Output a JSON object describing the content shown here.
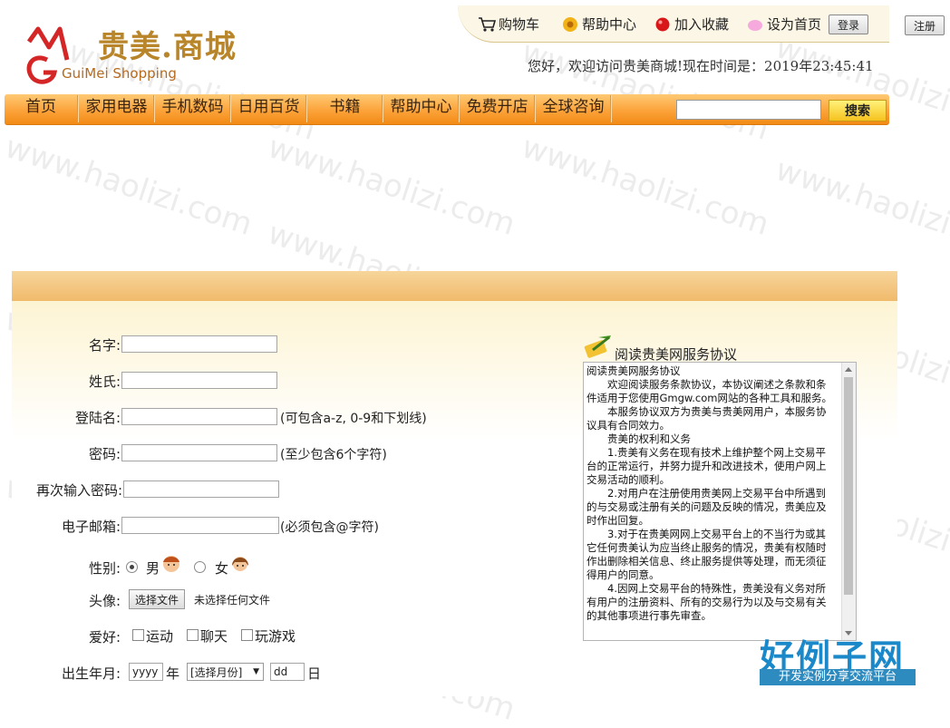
{
  "brand": {
    "name_cn": "贵美.商城",
    "name_en": "GuiMei Shopping",
    "color": "#b8852a"
  },
  "topnav": {
    "cart": "购物车",
    "help": "帮助中心",
    "favorite": "加入收藏",
    "homepage": "设为首页",
    "login": "登录",
    "register": "注册"
  },
  "welcome": "您好，欢迎访问贵美商城!现在时间是：2019年23:45:41",
  "nav": {
    "items": [
      "首页",
      "家用电器",
      "手机数码",
      "日用百货",
      "书籍",
      "帮助中心",
      "免费开店",
      "全球咨询"
    ],
    "search_button": "搜索",
    "accent": "#f6a23a"
  },
  "form": {
    "first_name_label": "名字:",
    "last_name_label": "姓氏:",
    "username_label": "登陆名:",
    "username_hint": "(可包含a-z, 0-9和下划线)",
    "password_label": "密码:",
    "password_hint": "(至少包含6个字符)",
    "password2_label": "再次输入密码:",
    "email_label": "电子邮箱:",
    "email_hint": "(必须包含@字符)",
    "gender_label": "性别:",
    "male": "男",
    "female": "女",
    "avatar_label": "头像:",
    "file_button": "选择文件",
    "file_status": "未选择任何文件",
    "hobby_label": "爱好:",
    "hobbies": [
      "运动",
      "聊天",
      "玩游戏"
    ],
    "birth_label": "出生年月:",
    "year_placeholder": "yyyy",
    "year_unit": "年",
    "month_select": "[选择月份]",
    "day_placeholder": "dd",
    "day_unit": "日"
  },
  "agreement": {
    "title": "阅读贵美网服务协议",
    "paragraphs": [
      "阅读贵美网服务协议",
      "　　欢迎阅读服务条款协议，本协议阐述之条款和条件适用于您使用Gmgw.com网站的各种工具和服务。",
      "　　本服务协议双方为贵美与贵美网用户，本服务协议具有合同效力。",
      "　　贵美的权利和义务",
      "　　1.贵美有义务在现有技术上维护整个网上交易平台的正常运行，并努力提升和改进技术，使用户网上交易活动的顺利。",
      "　　2.对用户在注册使用贵美网上交易平台中所遇到的与交易或注册有关的问题及反映的情况，贵美应及时作出回复。",
      "　　3.对于在贵美网网上交易平台上的不当行为或其它任何贵美认为应当终止服务的情况，贵美有权随时作出删除相关信息、终止服务提供等处理，而无须征得用户的同意。",
      "　　4.因网上交易平台的特殊性，贵美没有义务对所有用户的注册资料、所有的交易行为以及与交易有关的其他事项进行事先审查。"
    ]
  },
  "watermark": {
    "text": "www.haolizi.com",
    "corner_cn": "好例子网",
    "corner_sub": "开发实例分享交流平台"
  }
}
